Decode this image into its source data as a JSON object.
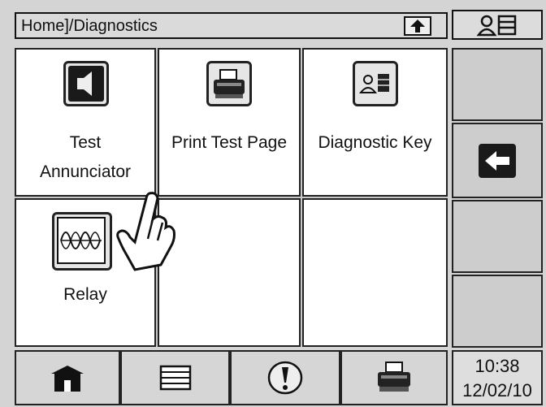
{
  "header": {
    "breadcrumb": "Home]/Diagnostics"
  },
  "header_icons": {
    "up": "up-arrow-icon",
    "user_menu": "user-list-icon"
  },
  "menu": {
    "items": [
      {
        "label": "Test Annunciator",
        "label_line1": "Test",
        "label_line2": "Annunciator",
        "icon": "speaker-icon"
      },
      {
        "label": "Print Test Page",
        "icon": "printer-icon"
      },
      {
        "label": "Diagnostic Key",
        "icon": "user-key-icon"
      },
      {
        "label": "Relay",
        "icon": "relay-waveform-icon"
      }
    ]
  },
  "sidebar": {
    "back_icon": "back-arrow-icon"
  },
  "footer": {
    "buttons": [
      {
        "icon": "home-icon"
      },
      {
        "icon": "list-icon"
      },
      {
        "icon": "alert-icon"
      },
      {
        "icon": "printer-icon"
      }
    ],
    "time": "10:38",
    "date": "12/02/10"
  },
  "colors": {
    "frame": "#111111",
    "cell_bg": "#ffffff",
    "panel": "#d4d4d4"
  }
}
